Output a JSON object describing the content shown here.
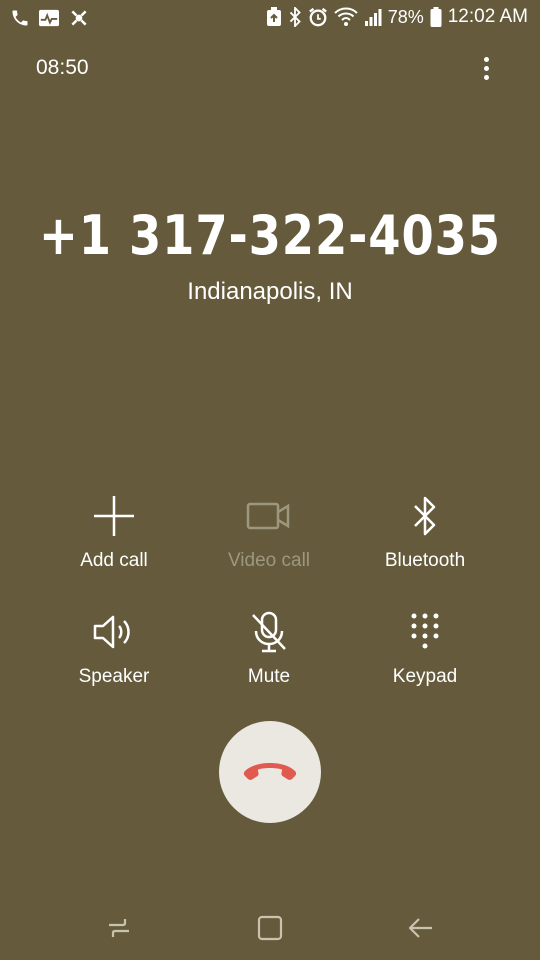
{
  "status_bar": {
    "battery_percent": "78%",
    "time": "12:02 AM",
    "left_icons": [
      "phone-icon",
      "activity-icon",
      "gesture-icon"
    ],
    "right_icons": [
      "recycle-icon",
      "bluetooth-icon",
      "alarm-icon",
      "wifi-icon",
      "signal-icon",
      "battery-icon"
    ]
  },
  "call": {
    "timer": "08:50",
    "number": "+1 317-322-4035",
    "location": "Indianapolis, IN"
  },
  "actions": {
    "add_call": "Add call",
    "video_call": "Video call",
    "bluetooth": "Bluetooth",
    "speaker": "Speaker",
    "mute": "Mute",
    "keypad": "Keypad"
  },
  "colors": {
    "background": "#655b3c",
    "end_call_button": "#ebe8e2",
    "end_call_icon": "#e05a4f",
    "disabled_text": "#9e977f"
  },
  "nav_bar": {
    "icons": [
      "recent-apps-icon",
      "home-icon",
      "back-icon"
    ]
  }
}
